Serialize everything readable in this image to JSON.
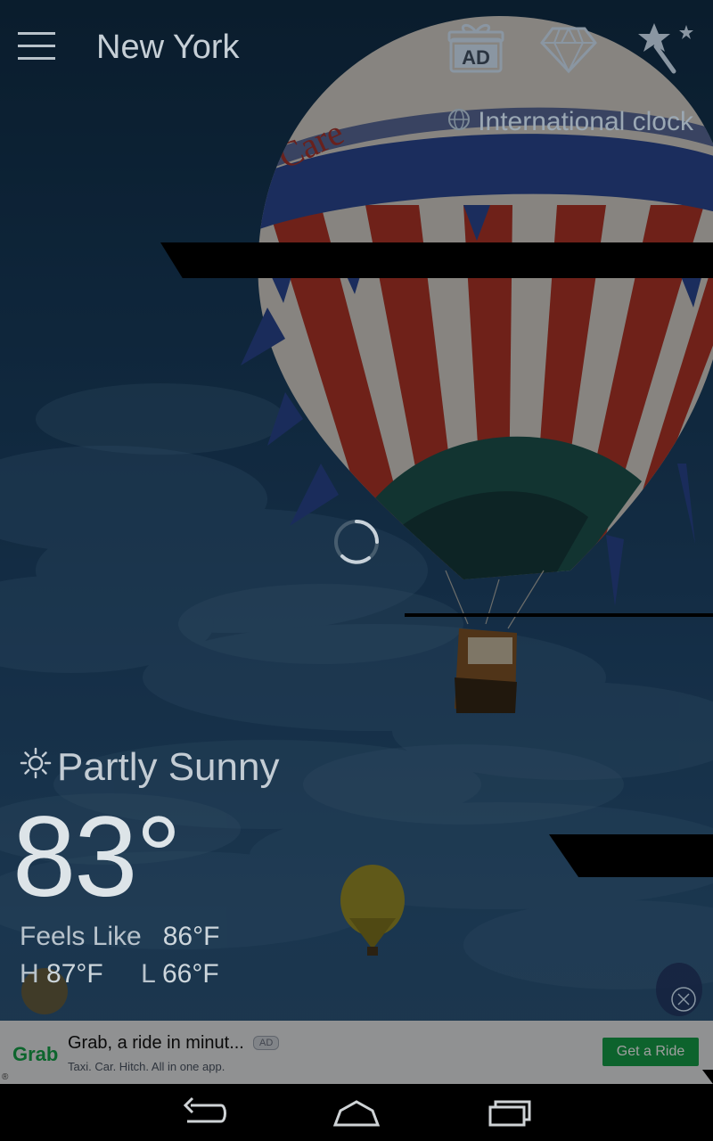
{
  "topbar": {
    "city": "New York",
    "icons": [
      "menu-icon",
      "ad-gift-icon",
      "diamond-icon",
      "magic-wand-icon"
    ],
    "ad_icon_label": "AD",
    "intl_clock": "International clock"
  },
  "weather": {
    "condition": "Partly Sunny",
    "temperature": "83°",
    "feels_label": "Feels Like",
    "feels_value": "86°F",
    "high_label": "H",
    "high_value": "87°F",
    "low_label": "L",
    "low_value": "66°F"
  },
  "ad": {
    "logo": "Grab",
    "title": "Grab, a ride in minut...",
    "badge": "AD",
    "subtitle": "Taxi. Car. Hitch. All in one app.",
    "cta": "Get a Ride"
  },
  "navbar": {
    "icons": [
      "back-icon",
      "home-icon",
      "recents-icon"
    ]
  },
  "colors": {
    "accent_green": "#15a049",
    "sky": "#1a4266"
  }
}
